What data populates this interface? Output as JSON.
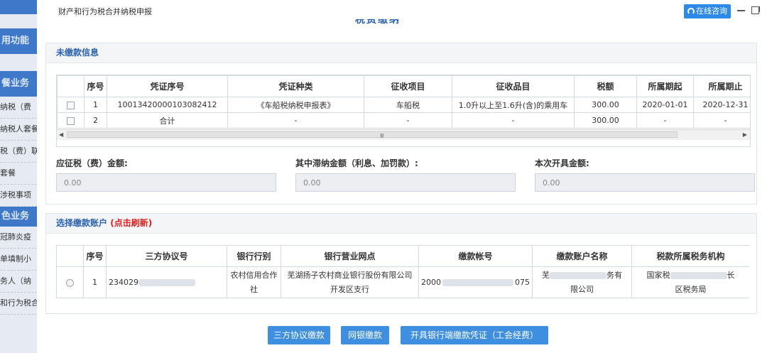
{
  "sidebar": {
    "sections": [
      {
        "label": "用功能"
      },
      {
        "label": "餐业务"
      },
      {
        "label": "色业务"
      }
    ],
    "items_a": [
      "纳税（费",
      "纳税人套餐",
      "税（费）联",
      "套餐",
      "涉税事项"
    ],
    "items_b": [
      "冠肺炎疫",
      "单填制小",
      "务人（纳",
      "和行为税合"
    ]
  },
  "dialog": {
    "title": "财产和行为税合并纳税申报",
    "consult_label": "在线咨询",
    "heading": "税费缴纳"
  },
  "unpaid": {
    "title": "未缴款信息",
    "columns": [
      "",
      "序号",
      "凭证序号",
      "凭证种类",
      "征收项目",
      "征收品目",
      "税额",
      "所属期起",
      "所属期止",
      ""
    ],
    "rows": [
      {
        "no": "1",
        "voucher_no": "10013420000103082412",
        "voucher_type": "《车船税纳税申报表》",
        "item": "车船税",
        "sub_item": "1.0升以上至1.6升(含)的乘用车",
        "tax": "300.00",
        "start": "2020-01-01",
        "end": "2020-12-31",
        "extra": "2"
      },
      {
        "no": "2",
        "voucher_no": "合计",
        "voucher_type": "-",
        "item": "-",
        "sub_item": "-",
        "tax": "300.00",
        "start": "-",
        "end": "-",
        "extra": ""
      }
    ],
    "scroll_grip": "Ⅲ"
  },
  "amounts": {
    "due_label": "应征税（费）金额:",
    "due_value": "0.00",
    "late_label": "其中滞纳金额（利息、加罚款）:",
    "late_value": "0.00",
    "issue_label": "本次开具金额:",
    "issue_value": "0.00"
  },
  "account": {
    "title": "选择缴款账户",
    "refresh_label": "(点击刷新)",
    "columns": [
      "",
      "序号",
      "三方协议号",
      "银行行别",
      "银行营业网点",
      "缴款帐号",
      "缴款账户名称",
      "税款所属税务机构"
    ],
    "row": {
      "no": "1",
      "agreement": "234029",
      "bank": "农村信用合作社",
      "branch_line1": "芜湖扬子农村商业银行股份有限公司",
      "branch_line2": "开发区支行",
      "account_start": "2000",
      "account_end": "075",
      "name_line1_a": "芜",
      "name_line1_b": "务有",
      "name_line2": "限公司",
      "org_line1_a": "国家税",
      "org_line1_b": "长",
      "org_line2": "区税务局"
    }
  },
  "buttons": {
    "tripartite": "三方协议缴款",
    "online_bank": "网银缴款",
    "issue_voucher": "开具银行端缴款凭证（工会经费）"
  }
}
